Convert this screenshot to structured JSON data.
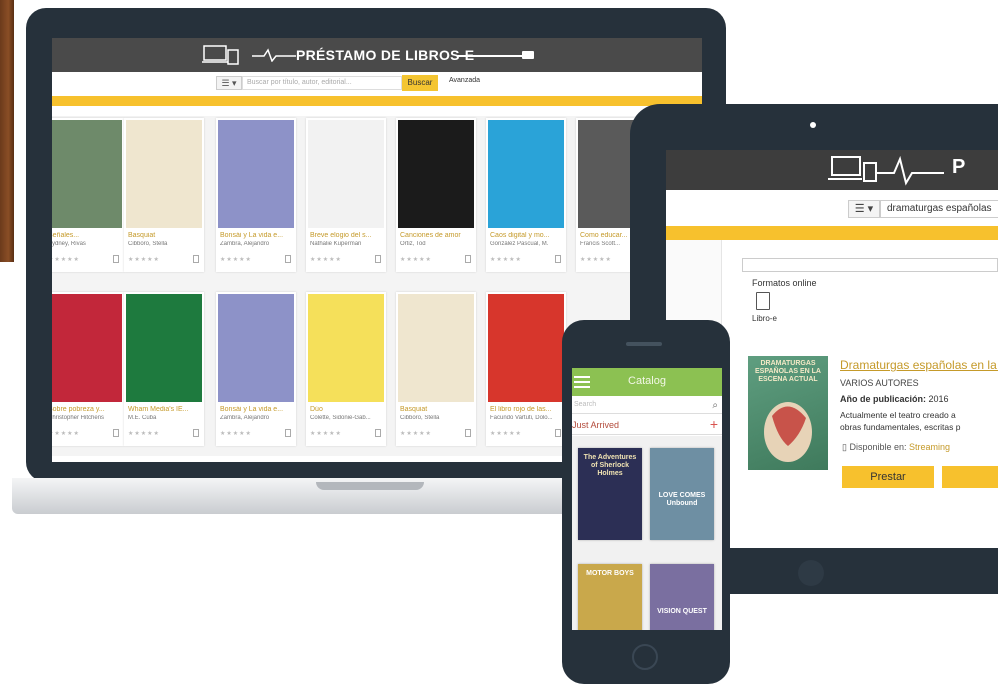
{
  "laptop": {
    "site_title": "PRÉSTAMO DE LIBROS-E",
    "menu_icon": "☰ ▾",
    "search_placeholder": "Buscar por título, autor, editorial...",
    "search_button": "Buscar",
    "advanced_link": "Avanzada",
    "books": [
      {
        "title": "Señales...",
        "author": "Sydney, Rivas",
        "cover": "#6e8a6a"
      },
      {
        "title": "Basquiat",
        "author": "Cibboro, Stella",
        "cover": "#efe6cf"
      },
      {
        "title": "Bonsái y La vida e...",
        "author": "Zambra, Alejandro",
        "cover": "#8d92c8"
      },
      {
        "title": "Breve elogio del s...",
        "author": "Nathalie Kuperman",
        "cover": "#f2f2f2"
      },
      {
        "title": "Canciones de amor",
        "author": "Ortiz, Tod",
        "cover": "#1b1b1b"
      },
      {
        "title": "Caos digital y mo...",
        "author": "González Pascual, M.",
        "cover": "#2aa3d8"
      },
      {
        "title": "Como educar...",
        "author": "Francis Scott...",
        "cover": "#5a5a5a"
      },
      {
        "title": "Sobre pobreza y...",
        "author": "Christopher Hitchens",
        "cover": "#c2273a"
      },
      {
        "title": "Wham Media's IE...",
        "author": "M.E. Cuba",
        "cover": "#1e7a3e"
      },
      {
        "title": "Bonsái y La vida e...",
        "author": "Zambra, Alejandro",
        "cover": "#8d92c8"
      },
      {
        "title": "Dúo",
        "author": "Colette, Sidonie-Gab...",
        "cover": "#f5e05a"
      },
      {
        "title": "Basquiat",
        "author": "Cibboro, Stella",
        "cover": "#efe6cf"
      },
      {
        "title": "El libro rojo de las...",
        "author": "Facundo Vartuti, Dolo...",
        "cover": "#d7362c"
      }
    ],
    "rating_stars": "★★★★★"
  },
  "tablet": {
    "site_title": "P",
    "menu_icon": "☰ ▾",
    "search_query": "dramaturgas españolas",
    "formats_label": "Formatos online",
    "format_item": "Libro-e",
    "book_cover_text": "DRAMATURGAS ESPAÑOLAS EN LA ESCENA ACTUAL",
    "book_title": "Dramaturgas españolas en la escena actual",
    "book_author": "VARIOS AUTORES",
    "year_label": "Año de publicación:",
    "year_value": "2016",
    "description_line1": "Actualmente el teatro creado a",
    "description_line2": "obras fundamentales, escritas p",
    "available_label": "Disponible en:",
    "available_value": "Streaming",
    "lend_button": "Prestar"
  },
  "phone": {
    "app_title": "Catalog",
    "search_placeholder": "Search",
    "section_title": "Just Arrived",
    "books": [
      {
        "text": "The Adventures of Sherlock Holmes",
        "cover": "#2c2f55"
      },
      {
        "text": "LOVE COMES Unbound",
        "cover": "#6e8fa3"
      },
      {
        "text": "MOTOR BOYS",
        "cover": "#c9a84b"
      },
      {
        "text": "VISION QUEST",
        "cover": "#7a6fa0"
      }
    ]
  },
  "colors": {
    "accent_yellow": "#f7c12d",
    "header_dark": "#4a4a4a",
    "device_frame": "#26313b",
    "phone_green": "#8cc152",
    "link_gold": "#c59a2a"
  }
}
